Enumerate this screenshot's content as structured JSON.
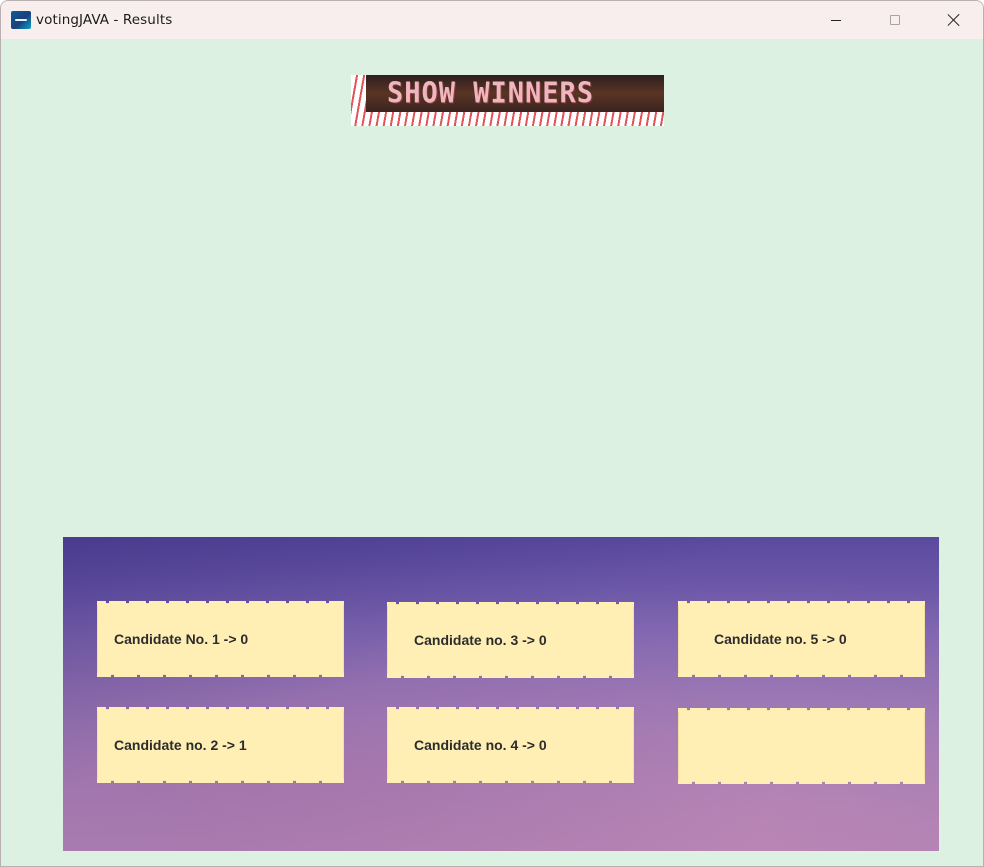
{
  "window": {
    "title": "votingJAVA - Results",
    "icon": "app-icon",
    "controls": [
      "minimize-icon",
      "maximize-icon",
      "close-icon"
    ]
  },
  "main": {
    "show_winners_label": "SHOW WINNERS"
  },
  "results": {
    "items": [
      {
        "label": "Candidate No. 1 -> 0"
      },
      {
        "label": "Candidate no. 2 -> 1"
      },
      {
        "label": "Candidate no. 3 -> 0"
      },
      {
        "label": "Candidate no. 4 -> 0"
      },
      {
        "label": "Candidate no. 5 -> 0"
      },
      {
        "label": ""
      }
    ]
  },
  "colors": {
    "background": "#dcf1e2",
    "titlebar": "#f8eeee",
    "note": "#ffefb5",
    "panel_top": "#5a4a9e",
    "panel_bottom": "#a97fb4"
  }
}
